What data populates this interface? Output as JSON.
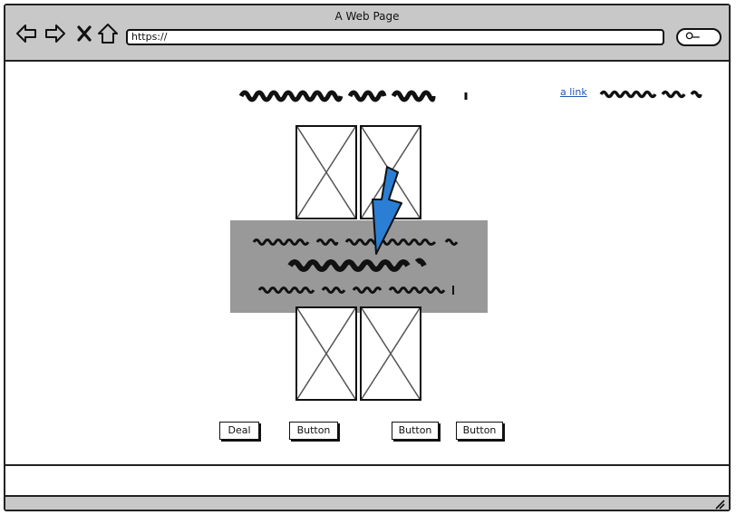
{
  "window": {
    "title": "A Web Page"
  },
  "address_bar": {
    "url": "https://"
  },
  "header": {
    "link_text": "a link"
  },
  "buttons": {
    "deal": "Deal",
    "button_1": "Button",
    "button_2": "Button",
    "button_3": "Button"
  },
  "colors": {
    "chrome": "#c8c8c8",
    "overlay": "#999999",
    "arrow": "#2a7fd4",
    "link": "#2156b8"
  }
}
